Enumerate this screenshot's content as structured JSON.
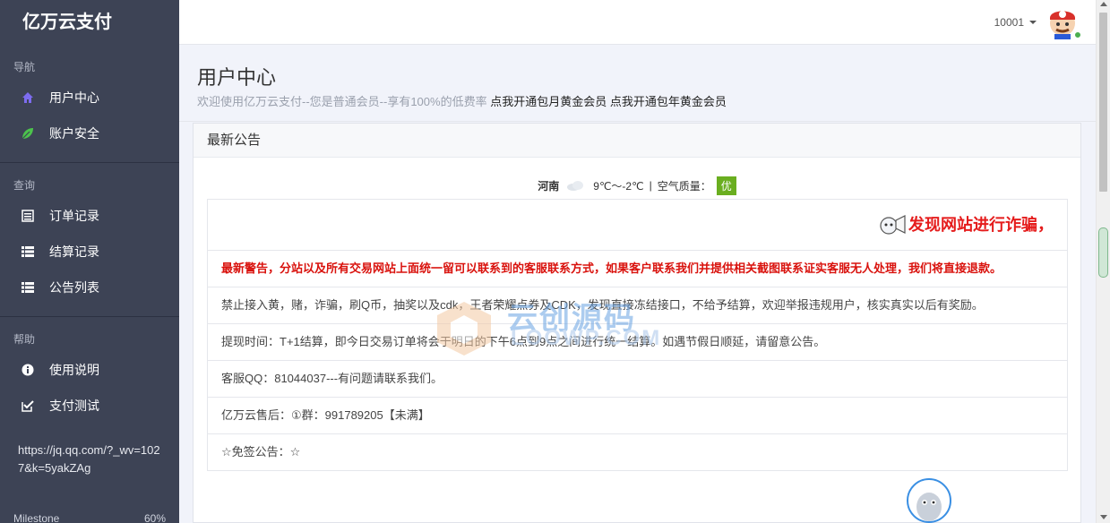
{
  "sidebar": {
    "brand": "亿万云支付",
    "sections": {
      "nav": "导航",
      "query": "查询",
      "help": "帮助"
    },
    "items": {
      "user_center": "用户中心",
      "account_security": "账户安全",
      "order_records": "订单记录",
      "settlement_records": "结算记录",
      "announcement_list": "公告列表",
      "usage_guide": "使用说明",
      "payment_test": "支付测试"
    },
    "link": "https://jq.qq.com/?_wv=1027&k=5yakZAg",
    "milestone_label": "Milestone",
    "milestone_value": "60%"
  },
  "topbar": {
    "user_id": "10001"
  },
  "header": {
    "title": "用户中心",
    "subtitle": "欢迎使用亿万云支付--您是普通会员--享有100%的低费率",
    "link_monthly": "点我开通包月黄金会员",
    "link_yearly": "点我开通包年黄金会员"
  },
  "panel": {
    "title": "最新公告",
    "weather": {
      "city": "河南",
      "temp": "9℃～-2℃",
      "sep": "|",
      "aq_label": "空气质量：",
      "aq_value": "优"
    },
    "banner": "发现网站进行诈骗，",
    "rows": [
      "最新警告，分站以及所有交易网站上面统一留可以联系到的客服联系方式，如果客户联系我们并提供相关截图联系证实客服无人处理，我们将直接退款。",
      "禁止接入黄，赌，诈骗，刷Q币，抽奖以及cdk，王者荣耀点券及CDK，发现直接冻结接口，不给予结算，欢迎举报违规用户，核实真实以后有奖励。",
      "提现时间：T+1结算，即今日交易订单将会于明日的下午6点到9点之间进行统一结算。如遇节假日顺延，请留意公告。",
      "客服QQ：81044037---有问题请联系我们。",
      "亿万云售后：①群：991789205【未满】",
      "☆免签公告：☆"
    ]
  },
  "watermark": {
    "line1": "云创源码",
    "line2": "LOOWP.COM"
  },
  "colors": {
    "sidebar_bg": "#3d4355",
    "warning_red": "#d9120d",
    "badge_green": "#6aae20"
  }
}
